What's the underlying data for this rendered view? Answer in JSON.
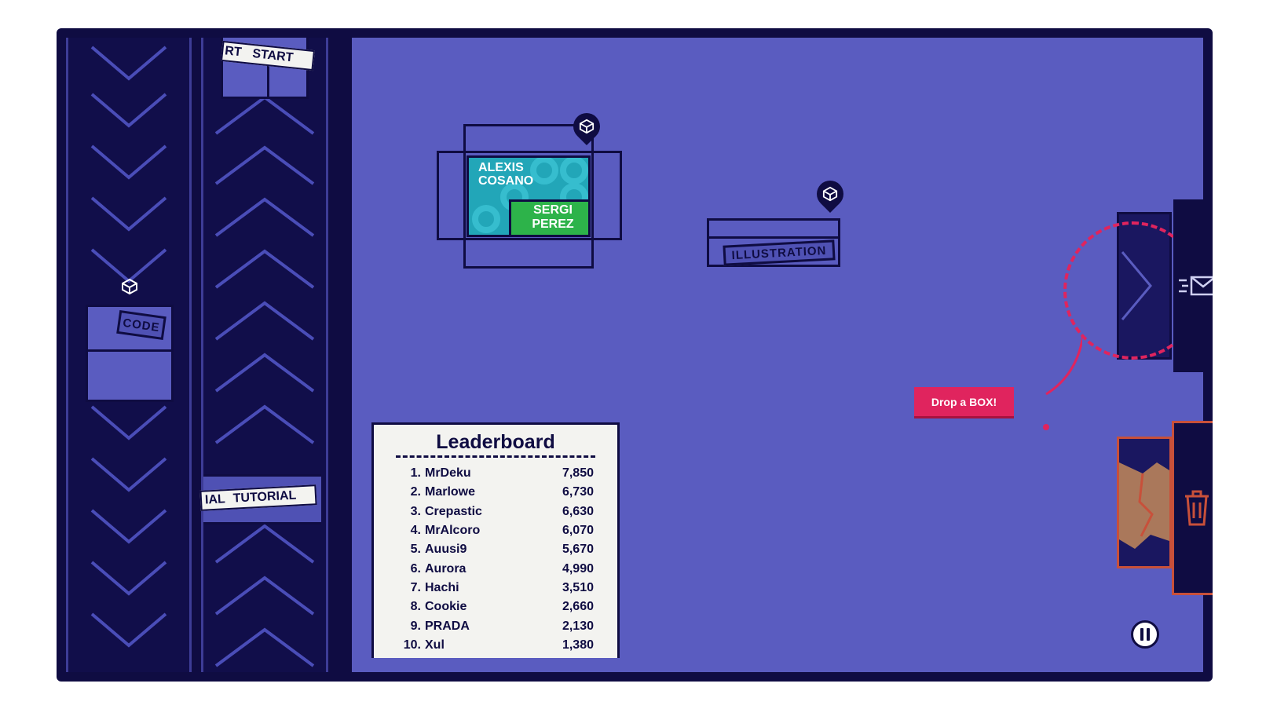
{
  "conveyors": {
    "left_box_label": "CODE",
    "right_top_label": "START",
    "right_top_label_partial": "RT",
    "right_bottom_label": "TUTORIAL",
    "right_bottom_label_partial": "IAL"
  },
  "boxes": {
    "names_box": {
      "name_1": "ALEXIS COSANO",
      "name_2": "SERGI PEREZ"
    },
    "illustration_box": {
      "label": "ILLUSTRATION"
    }
  },
  "leaderboard": {
    "title": "Leaderboard",
    "rows": [
      {
        "rank": "1.",
        "name": "MrDeku",
        "score": "7,850"
      },
      {
        "rank": "2.",
        "name": "Marlowe",
        "score": "6,730"
      },
      {
        "rank": "3.",
        "name": "Crepastic",
        "score": "6,630"
      },
      {
        "rank": "4.",
        "name": "MrAlcoro",
        "score": "6,070"
      },
      {
        "rank": "5.",
        "name": "Auusi9",
        "score": "5,670"
      },
      {
        "rank": "6.",
        "name": "Aurora",
        "score": "4,990"
      },
      {
        "rank": "7.",
        "name": "Hachi",
        "score": "3,510"
      },
      {
        "rank": "8.",
        "name": "Cookie",
        "score": "2,660"
      },
      {
        "rank": "9.",
        "name": "PRADA",
        "score": "2,130"
      },
      {
        "rank": "10.",
        "name": "Xul",
        "score": "1,380"
      }
    ]
  },
  "drop_zone": {
    "tooltip": "Drop a BOX!",
    "icon": "mail-icon"
  },
  "trash_zone": {
    "icon": "trash-icon"
  },
  "controls": {
    "pause_icon": "pause-icon"
  },
  "colors": {
    "background": "#5a5cc0",
    "dark": "#0f0c42",
    "accent": "#e0245e",
    "teal": "#22a6b8",
    "green": "#2db34a",
    "trash": "#c8503a"
  }
}
